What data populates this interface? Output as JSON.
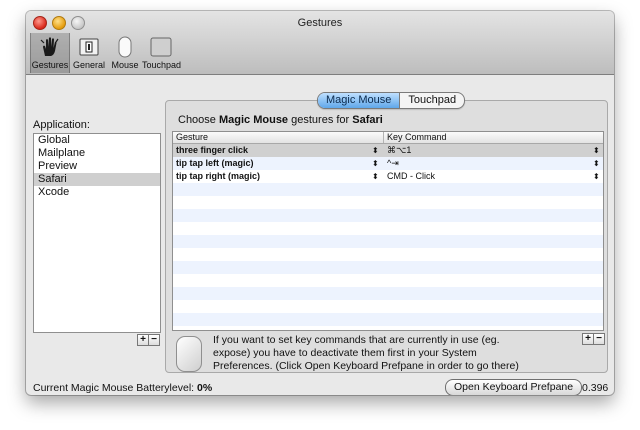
{
  "window": {
    "title": "Gestures"
  },
  "toolbar": {
    "items": [
      {
        "label": "Gestures",
        "icon": "hand-icon",
        "selected": true
      },
      {
        "label": "General",
        "icon": "switch-icon",
        "selected": false
      },
      {
        "label": "Mouse",
        "icon": "mouse-icon",
        "selected": false
      },
      {
        "label": "Touchpad",
        "icon": "touchpad-icon",
        "selected": false
      }
    ]
  },
  "applications": {
    "label": "Application:",
    "items": [
      "Global",
      "Mailplane",
      "Preview",
      "Safari",
      "Xcode"
    ],
    "selected": "Safari",
    "add_label": "+",
    "remove_label": "−"
  },
  "tabs": [
    {
      "label": "Magic Mouse",
      "active": true
    },
    {
      "label": "Touchpad",
      "active": false
    }
  ],
  "choose": {
    "prefix": "Choose",
    "device": "Magic Mouse",
    "middle": "gestures for",
    "app": "Safari"
  },
  "table": {
    "columns": [
      "Gesture",
      "Key Command"
    ],
    "rows": [
      {
        "gesture": "three finger click",
        "command": "⌘⌥1",
        "selected": true
      },
      {
        "gesture": "tip tap left (magic)",
        "command": "^⇥",
        "selected": false
      },
      {
        "gesture": "tip tap right (magic)",
        "command": "CMD - Click",
        "selected": false
      }
    ],
    "empty_rows": 11,
    "add_label": "+",
    "remove_label": "−"
  },
  "info": {
    "text": "If you want to set key commands that are currently in use (eg. expose) you have to deactivate them first in your System Preferences. (Click Open Keyboard Prefpane in order to go there)"
  },
  "footer": {
    "battery_label": "Current Magic Mouse Batterylevel:",
    "battery_value": "0%",
    "prefpane_button": "Open Keyboard Prefpane",
    "version": "0.396"
  },
  "colors": {
    "accent": "#5fa7ea",
    "selection": "#d0d0d0",
    "alt_row": "#edf3fe"
  }
}
